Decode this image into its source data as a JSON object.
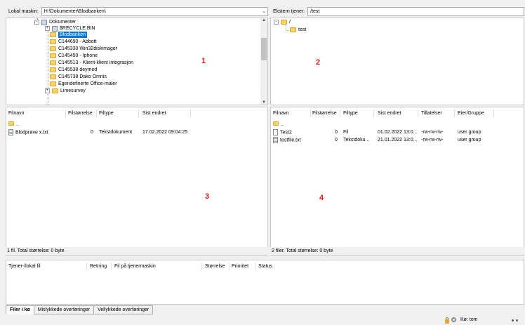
{
  "local_pathbar": {
    "label": "Lokal maskin:",
    "path": "H:\\Dokumenter\\Blodbanken\\"
  },
  "remote_pathbar": {
    "label": "Ekstern tjener:",
    "path": "/test"
  },
  "local_tree": [
    {
      "label": "Dokumenter",
      "icon": "documents-icon",
      "expander": "-"
    },
    {
      "label": "$RECYCLE.BIN",
      "icon": "recycle-bin-icon",
      "expander": "+"
    },
    {
      "label": "Blodbanken",
      "icon": "folder-icon",
      "selected": true
    },
    {
      "label": "C144690 - Abbott",
      "icon": "folder-icon"
    },
    {
      "label": "C145330 Win32diskimager",
      "icon": "folder-icon"
    },
    {
      "label": "C145450 - Iphone",
      "icon": "folder-icon"
    },
    {
      "label": "C145513 - Klient-klient integrasjon",
      "icon": "folder-icon"
    },
    {
      "label": "C145538 deymed",
      "icon": "folder-icon"
    },
    {
      "label": "C145738 Dako Omnis",
      "icon": "folder-icon"
    },
    {
      "label": "Egendefinerte Office-maler",
      "icon": "folder-icon"
    },
    {
      "label": "Limesurvey",
      "icon": "folder-icon",
      "expander": "+"
    }
  ],
  "remote_tree": [
    {
      "label": "/",
      "icon": "folder-icon",
      "expander": "-"
    },
    {
      "label": "test",
      "icon": "folder-icon"
    }
  ],
  "local_list": {
    "columns": [
      "Filnavn",
      "Filstørrelse",
      "Filtype",
      "Sist endret"
    ],
    "rows": [
      {
        "name": "..",
        "size": "",
        "type": "",
        "modified": "",
        "icon": "folder-icon"
      },
      {
        "name": "Blodprøve x.txt",
        "size": "0",
        "type": "Tekstdokument",
        "modified": "17.02.2022 09:04:25",
        "icon": "text-file-icon"
      }
    ],
    "status": "1 fil. Total størrelse: 0 byte"
  },
  "remote_list": {
    "columns": [
      "Filnavn",
      "Filstørrelse",
      "Filtype",
      "Sist endret",
      "Tillatelser",
      "Eier/Gruppe"
    ],
    "rows": [
      {
        "name": "..",
        "size": "",
        "type": "",
        "modified": "",
        "perms": "",
        "owner": "",
        "icon": "folder-icon"
      },
      {
        "name": "Test2",
        "size": "0",
        "type": "Fil",
        "modified": "01.02.2022 13:0...",
        "perms": "-rw-rw-rw-",
        "owner": "user group",
        "icon": "file-icon"
      },
      {
        "name": "testfile.txt",
        "size": "0",
        "type": "Tekstdoku...",
        "modified": "21.01.2022 13:0...",
        "perms": "-rw-rw-rw-",
        "owner": "user group",
        "icon": "text-file-icon"
      }
    ],
    "status": "2 filer. Total størrelse: 0 byte"
  },
  "queue": {
    "columns": [
      "Tjener-/lokal fil",
      "Retning",
      "Fil på tjenermaskin",
      "Størrelse",
      "Prioritet",
      "Status"
    ]
  },
  "tabs": [
    "Filer i kø",
    "Mislykkede overføringer",
    "Vellykkede overføringer"
  ],
  "bottom": {
    "queue_status": "Kø: tom"
  },
  "annotations": [
    "1",
    "2",
    "3",
    "4"
  ],
  "colors": {
    "selection": "#0078d7",
    "annotation": "#d11a1a",
    "folder": "#f6d468"
  }
}
